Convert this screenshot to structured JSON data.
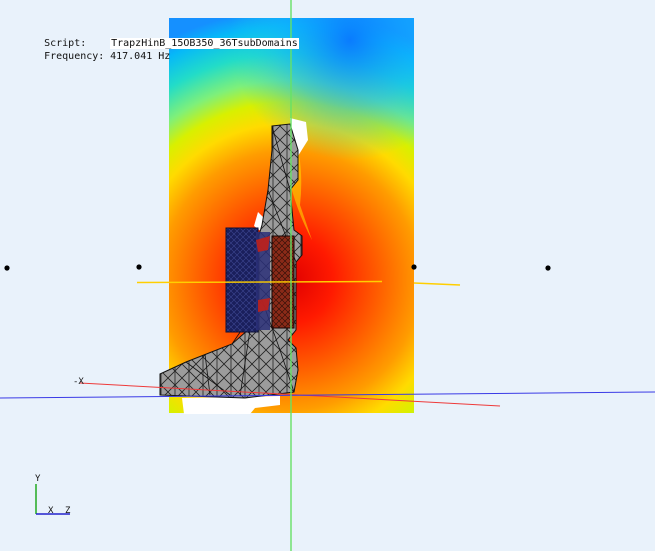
{
  "info": {
    "script_label": "Script:",
    "script_value": "TrapzHinB_15OB350_36TsubDomains",
    "frequency_label": "Frequency:",
    "frequency_value": "417.041 Hz"
  },
  "scene": {
    "axis_label_neg_x": "-X",
    "colors": {
      "background": "#e9f2fb",
      "field_hot": "#ff0000",
      "field_warm": "#ffd800",
      "field_mid": "#2fe8a8",
      "field_cold": "#00a6ff",
      "mesh_gray": "#9a9a9a",
      "mesh_navy": "#15194d",
      "axis_green": "#66e266",
      "axis_blue": "#3a3ae6",
      "axis_red": "#ee3a3a",
      "axis_yellow": "#ffcf00"
    }
  },
  "triad": {
    "y": "Y",
    "x": "X",
    "z": "Z"
  }
}
